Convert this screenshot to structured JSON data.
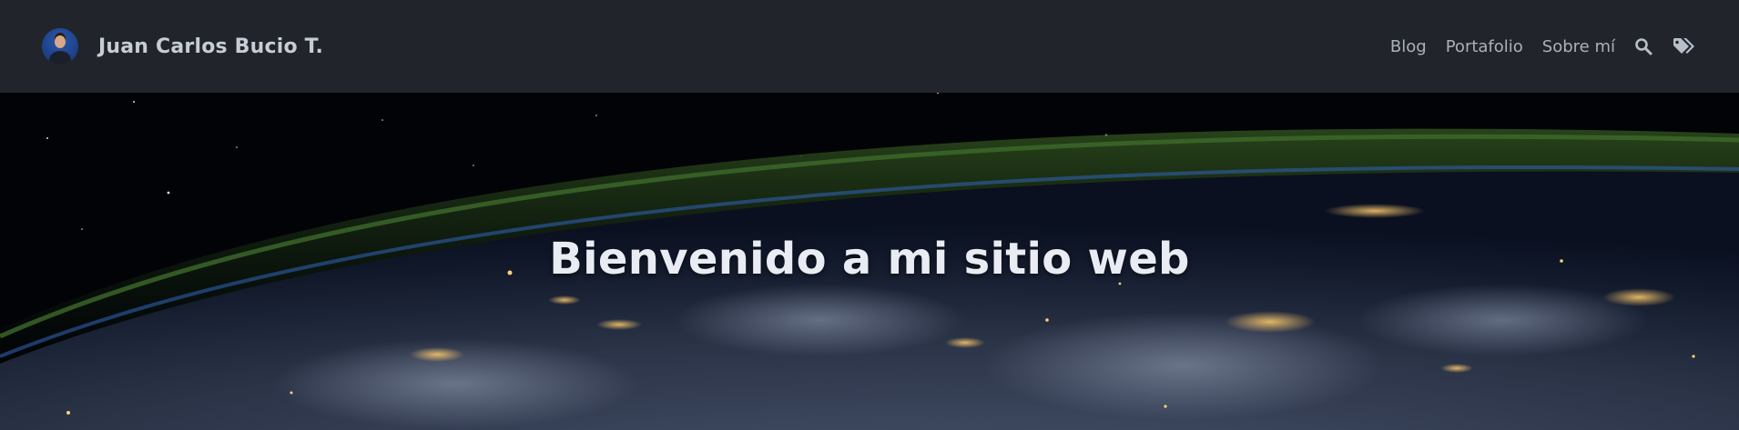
{
  "header": {
    "brand_name": "Juan Carlos Bucio T.",
    "avatar_icon": "avatar-photo",
    "nav": [
      {
        "label": "Blog"
      },
      {
        "label": "Portafolio"
      },
      {
        "label": "Sobre mí"
      }
    ],
    "icons": [
      "search-icon",
      "tags-icon"
    ],
    "colors": {
      "navbar_bg": "#21252b",
      "nav_text": "#aab1bb",
      "brand_text": "#c7cdd6"
    }
  },
  "hero": {
    "title": "Bienvenido a mi sitio web",
    "background_image": "earth-from-space-at-night"
  }
}
